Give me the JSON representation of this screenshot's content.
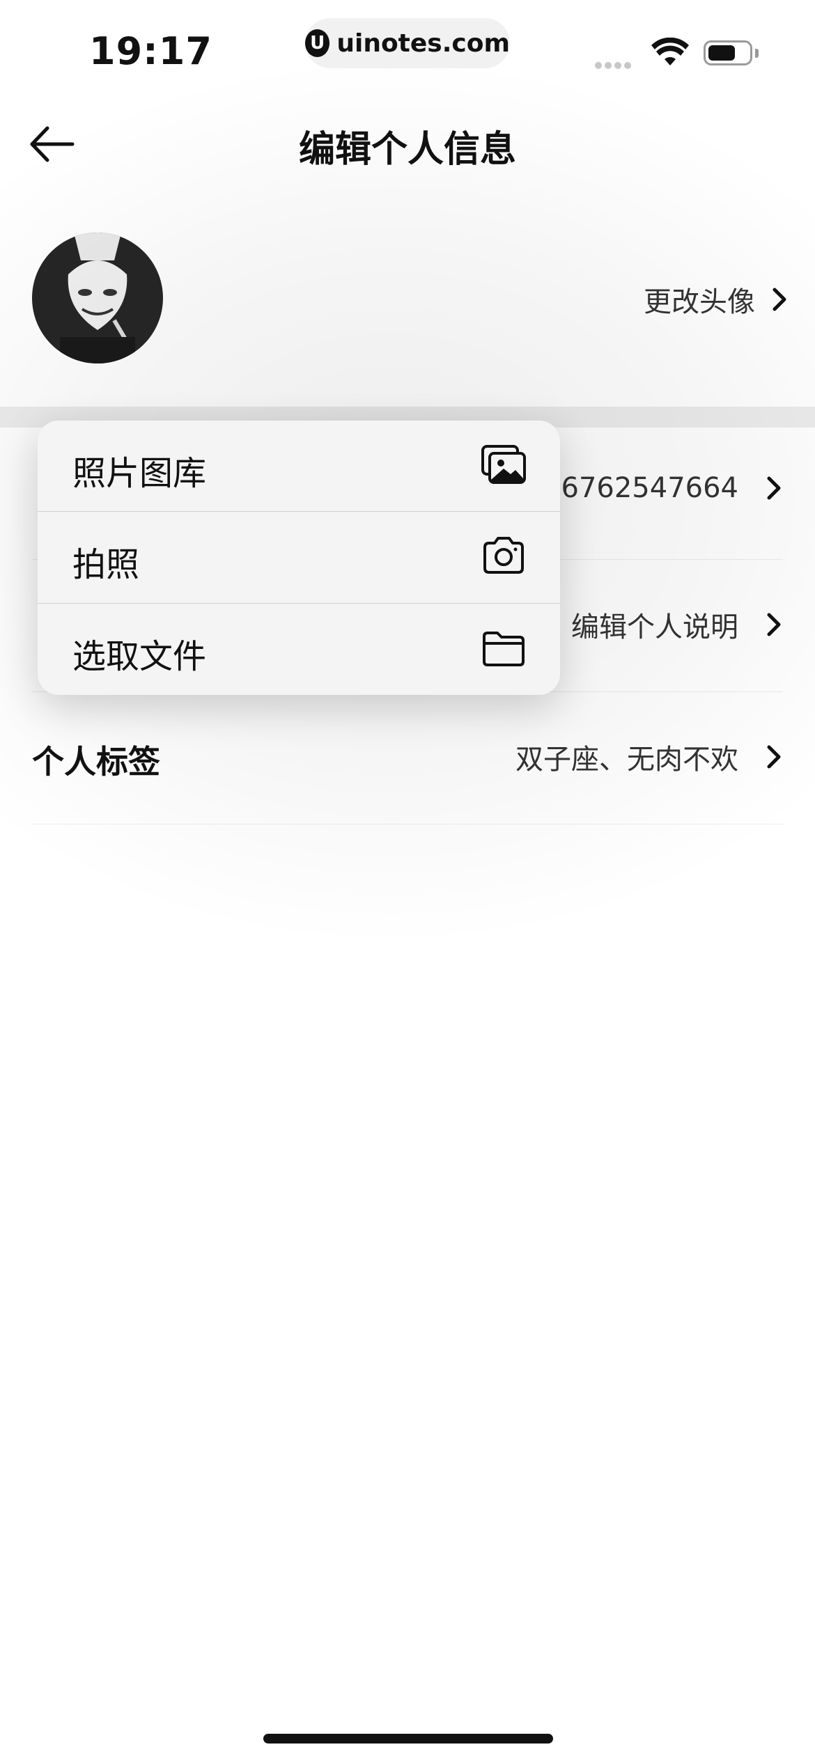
{
  "status_bar": {
    "time": "19:17",
    "url_logo_glyph": "U",
    "url": "uinotes.com",
    "icons": [
      "signal-icon",
      "wifi-icon",
      "battery-icon"
    ]
  },
  "nav": {
    "back_icon": "arrow-left-icon",
    "title": "编辑个人信息"
  },
  "avatar_row": {
    "action_label": "更改头像"
  },
  "rows": [
    {
      "label": "",
      "value": "16762547664"
    },
    {
      "label": "",
      "value": "编辑个人说明"
    },
    {
      "label": "个人标签",
      "value": "双子座、无肉不欢"
    }
  ],
  "picker_menu": {
    "items": [
      {
        "label": "照片图库",
        "icon": "photo-library-icon"
      },
      {
        "label": "拍照",
        "icon": "camera-icon"
      },
      {
        "label": "选取文件",
        "icon": "folder-icon"
      }
    ]
  }
}
